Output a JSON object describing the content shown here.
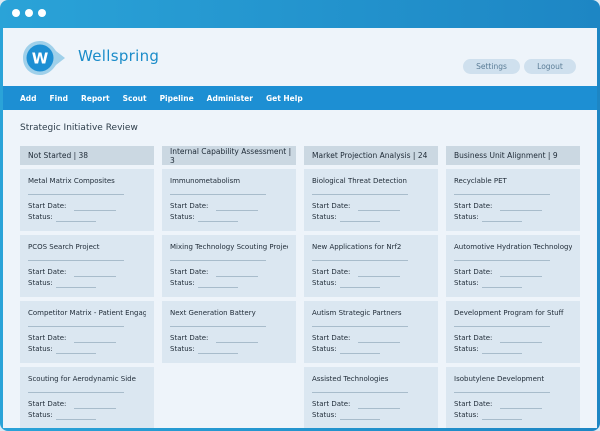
{
  "app": {
    "brand": "Wellspring",
    "logo_letter": "W"
  },
  "header": {
    "settings": "Settings",
    "logout": "Logout"
  },
  "nav": [
    "Add",
    "Find",
    "Report",
    "Scout",
    "Pipeline",
    "Administer",
    "Get Help"
  ],
  "page_title": "Strategic Initiative Review",
  "fields": {
    "start_label": "Start Date:",
    "status_label": "Status:"
  },
  "columns": [
    {
      "title": "Not Started | 38",
      "cards": [
        "Metal Matrix Composites",
        "PCOS Search Project",
        "Competitor Matrix - Patient Engage",
        "Scouting for Aerodynamic Side"
      ]
    },
    {
      "title": "Internal Capability Assessment | 3",
      "cards": [
        "Immunometabolism",
        "Mixing Technology Scouting Project",
        "Next Generation Battery"
      ]
    },
    {
      "title": "Market Projection Analysis | 24",
      "cards": [
        "Biological Threat Detection",
        "New Applications for Nrf2",
        "Autism Strategic Partners",
        "Assisted Technologies"
      ]
    },
    {
      "title": "Business Unit Alignment | 9",
      "cards": [
        "Recyclable PET",
        "Automotive Hydration Technology",
        "Development Program for Stuff",
        "Isobutylene Development"
      ]
    }
  ],
  "colors": {
    "frame": "#1d86c4",
    "nav": "#1d8fd3",
    "brand": "#1b8cc9",
    "card": "#dbe7f1",
    "column_header": "#cbd8e2"
  }
}
